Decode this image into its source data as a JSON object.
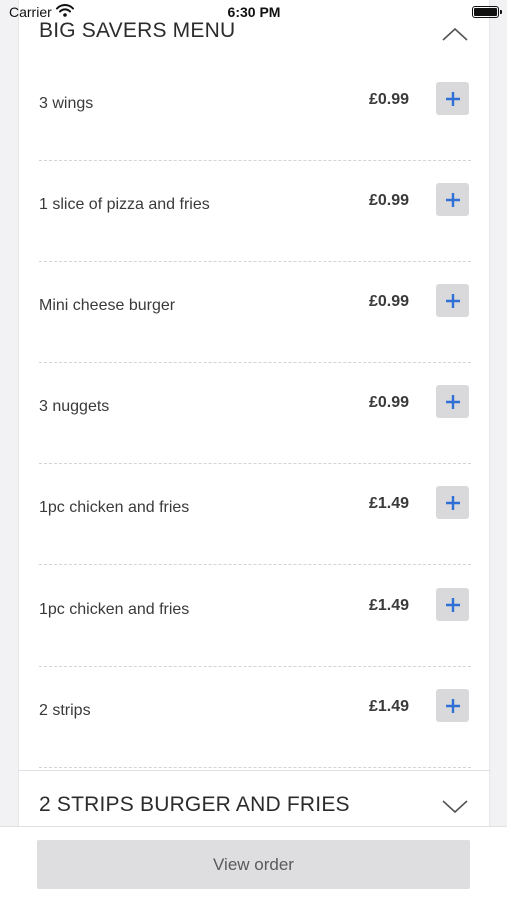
{
  "status_bar": {
    "carrier": "Carrier",
    "time": "6:30 PM"
  },
  "sections": [
    {
      "title": "BIG SAVERS MENU",
      "expanded": true,
      "chevron_icon": "chevron-up-icon",
      "items": [
        {
          "name": "3 wings",
          "price": "£0.99"
        },
        {
          "name": "1 slice of pizza and fries",
          "price": "£0.99"
        },
        {
          "name": "Mini cheese burger",
          "price": "£0.99"
        },
        {
          "name": "3 nuggets",
          "price": "£0.99"
        },
        {
          "name": "1pc chicken and fries",
          "price": "£1.49"
        },
        {
          "name": "1pc chicken and fries",
          "price": "£1.49"
        },
        {
          "name": "2 strips",
          "price": "£1.49"
        }
      ]
    },
    {
      "title": "2 STRIPS BURGER AND FRIES",
      "expanded": false,
      "chevron_icon": "chevron-down-icon"
    }
  ],
  "add_icon": "plus-icon",
  "colors": {
    "accent": "#2f6fd6",
    "button_bg": "#d9d9db"
  },
  "bottom_bar": {
    "view_order_label": "View order"
  }
}
